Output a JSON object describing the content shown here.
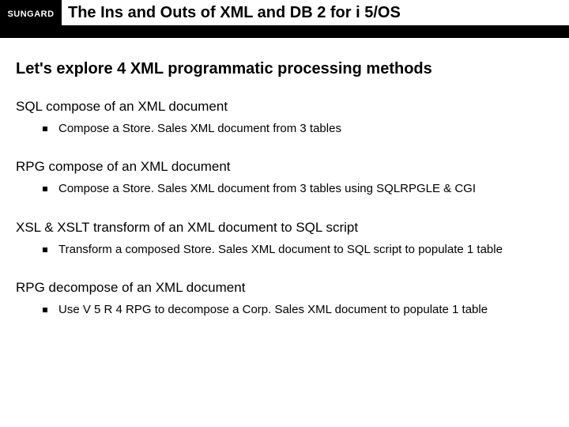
{
  "header": {
    "logo": "SUNGARD",
    "title": "The Ins and Outs of XML and DB 2 for i 5/OS"
  },
  "subtitle": "Let's explore 4 XML programmatic processing methods",
  "sections": [
    {
      "heading": "SQL compose of an XML document",
      "bullet": "Compose a Store. Sales XML document from 3 tables"
    },
    {
      "heading": "RPG compose of an XML document",
      "bullet": "Compose a Store. Sales XML document from 3 tables using SQLRPGLE & CGI"
    },
    {
      "heading": "XSL & XSLT transform of an XML document to SQL script",
      "bullet": "Transform a composed Store. Sales XML document to SQL script to populate 1 table"
    },
    {
      "heading": "RPG decompose of an XML document",
      "bullet": "Use V 5 R 4 RPG to decompose a Corp. Sales XML document to populate 1 table"
    }
  ]
}
